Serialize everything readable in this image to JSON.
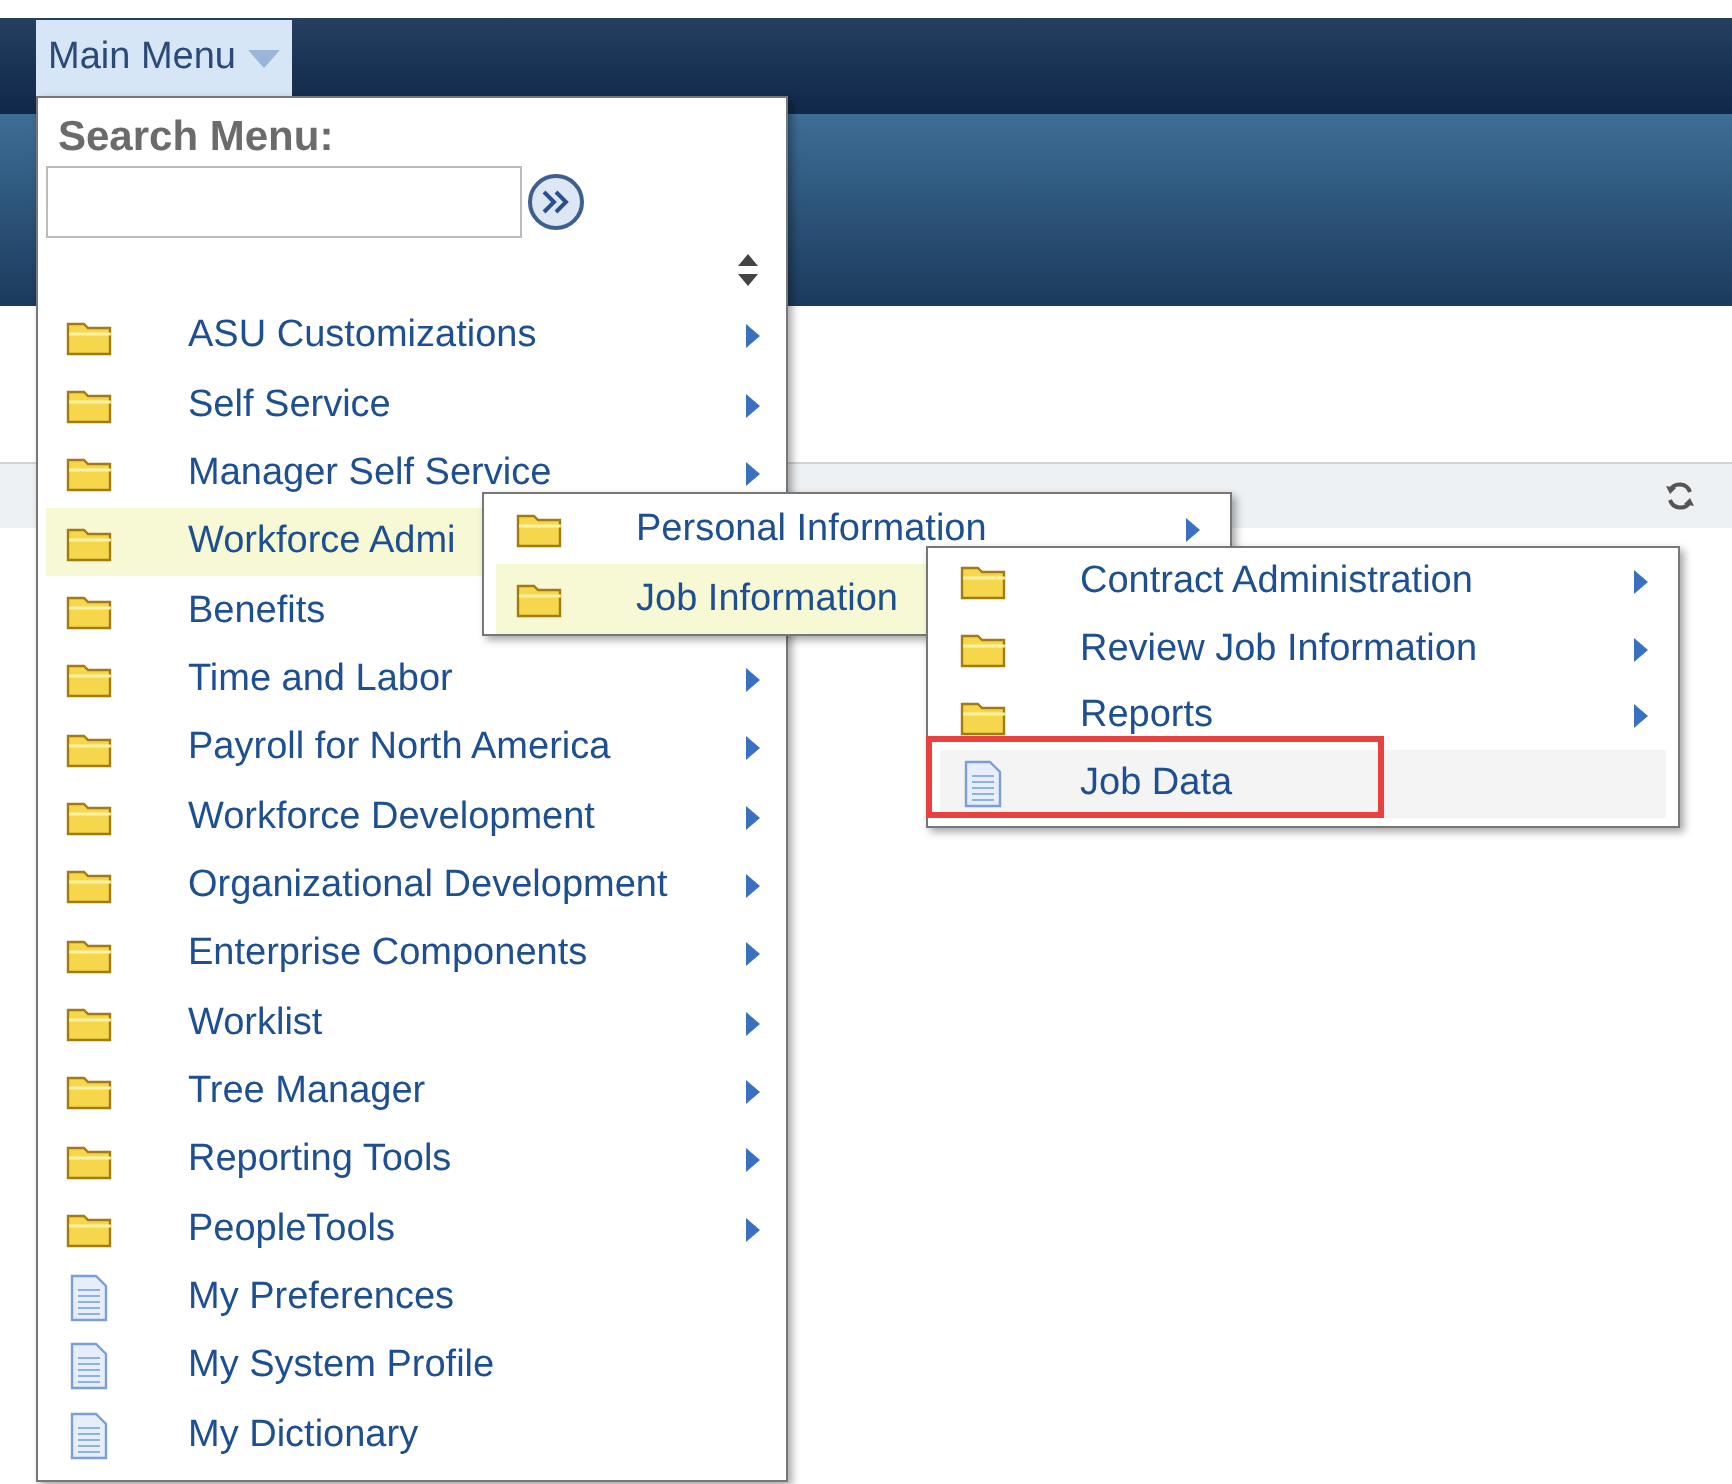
{
  "main_menu_button": {
    "label": "Main Menu",
    "expanded": true
  },
  "search": {
    "label": "Search Menu:"
  },
  "menu": [
    {
      "kind": "folder",
      "label": "ASU Customizations",
      "arrow": true,
      "selected": false
    },
    {
      "kind": "folder",
      "label": "Self Service",
      "arrow": true,
      "selected": false
    },
    {
      "kind": "folder",
      "label": "Manager Self Service",
      "arrow": true,
      "selected": false
    },
    {
      "kind": "folder",
      "label": "Workforce Admi",
      "selected": true
    },
    {
      "kind": "folder",
      "label": "Benefits",
      "selected": false
    },
    {
      "kind": "folder",
      "label": "Time and Labor",
      "arrow": true,
      "selected": false
    },
    {
      "kind": "folder",
      "label": "Payroll for North America",
      "arrow": true,
      "selected": false
    },
    {
      "kind": "folder",
      "label": "Workforce Development",
      "arrow": true,
      "selected": false
    },
    {
      "kind": "folder",
      "label": "Organizational Development",
      "arrow": true,
      "selected": false
    },
    {
      "kind": "folder",
      "label": "Enterprise Components",
      "arrow": true,
      "selected": false
    },
    {
      "kind": "folder",
      "label": "Worklist",
      "arrow": true,
      "selected": false
    },
    {
      "kind": "folder",
      "label": "Tree Manager",
      "arrow": true,
      "selected": false
    },
    {
      "kind": "folder",
      "label": "Reporting Tools",
      "arrow": true,
      "selected": false
    },
    {
      "kind": "folder",
      "label": "PeopleTools",
      "arrow": true,
      "selected": false
    },
    {
      "kind": "page",
      "label": "My Preferences",
      "arrow": false,
      "selected": false
    },
    {
      "kind": "page",
      "label": "My System Profile",
      "arrow": false,
      "selected": false
    },
    {
      "kind": "page",
      "label": "My Dictionary",
      "arrow": false,
      "selected": false
    }
  ],
  "submenu_1": [
    {
      "kind": "folder",
      "label": "Personal Information",
      "arrow": true,
      "selected": false
    },
    {
      "kind": "folder",
      "label": "Job Information",
      "selected": true
    }
  ],
  "submenu_2": [
    {
      "kind": "folder",
      "label": "Contract Administration",
      "arrow": true,
      "selected": false,
      "outlined": false
    },
    {
      "kind": "folder",
      "label": "Review Job Information",
      "arrow": true,
      "selected": false,
      "outlined": false
    },
    {
      "kind": "folder",
      "label": "Reports",
      "arrow": true,
      "selected": false,
      "outlined": false
    },
    {
      "kind": "page",
      "label": "Job Data",
      "arrow": false,
      "selected": true,
      "outlined": true
    }
  ]
}
